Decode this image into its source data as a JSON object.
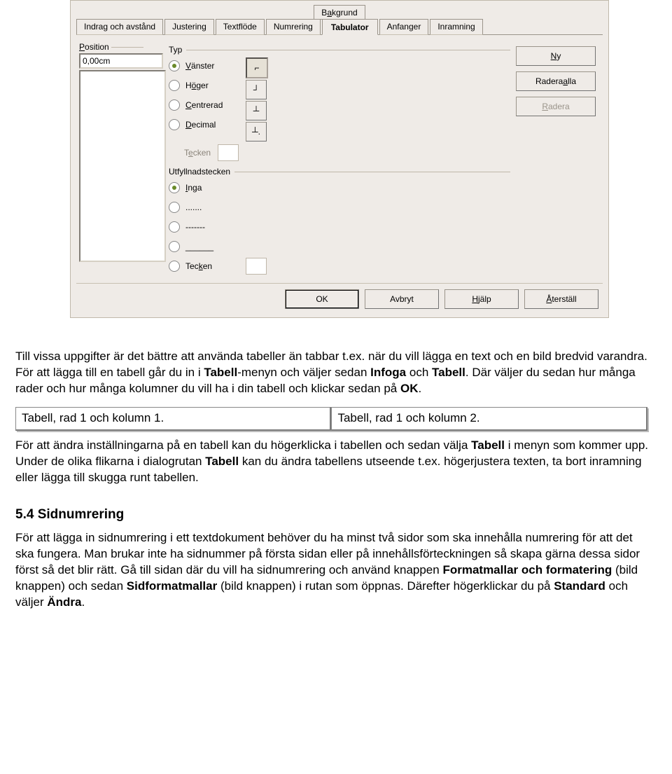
{
  "dialog": {
    "tabs_row1": [
      {
        "label": "Bakgrund",
        "accel": "a"
      }
    ],
    "tabs_row2": [
      {
        "label": "Indrag och avstånd",
        "accel": ""
      },
      {
        "label": "Justering",
        "accel": ""
      },
      {
        "label": "Textflöde",
        "accel": ""
      },
      {
        "label": "Numrering",
        "accel": ""
      },
      {
        "label": "Tabulator",
        "accel": "",
        "active": true
      },
      {
        "label": "Anfanger",
        "accel": ""
      },
      {
        "label": "Inramning",
        "accel": ""
      }
    ],
    "groups": {
      "position": {
        "legend": "Position",
        "accel": "P",
        "value": "0,00cm"
      },
      "typ": {
        "legend": "Typ",
        "options": [
          {
            "label": "Vänster",
            "accel": "V",
            "checked": true
          },
          {
            "label": "Höger",
            "accel": "ö"
          },
          {
            "label": "Centrerad",
            "accel": "C"
          },
          {
            "label": "Decimal",
            "accel": "D"
          }
        ],
        "tecken_label": "Tecken",
        "accel": "e"
      },
      "fill": {
        "legend": "Utfyllnadstecken",
        "options": [
          {
            "label": "Inga",
            "accel": "I",
            "checked": true
          },
          {
            "label": ".......",
            "accel": "."
          },
          {
            "label": "-------",
            "accel": "-"
          },
          {
            "label": "______",
            "accel": "_"
          },
          {
            "label": "Tecken",
            "accel": "T"
          }
        ]
      }
    },
    "side_buttons": [
      {
        "label": "Ny",
        "accel": "N"
      },
      {
        "label": "Radera alla",
        "accel": "a"
      },
      {
        "label": "Radera",
        "accel": "R",
        "disabled": true
      }
    ],
    "bottom": [
      {
        "label": "OK",
        "default": true
      },
      {
        "label": "Avbryt"
      },
      {
        "label": "Hjälp",
        "accel": "H"
      },
      {
        "label": "Återställ",
        "accel": "Å"
      }
    ]
  },
  "article": {
    "p1_a": "Till vissa uppgifter är det bättre att använda tabeller än tabbar t.ex. när du vill lägga en text och en bild bredvid varandra. För att lägga till en tabell går du in i ",
    "p1_b1": "Tabell",
    "p1_c": "-menyn och väljer sedan ",
    "p1_b2": "Infoga",
    "p1_d": " och ",
    "p1_b3": "Tabell",
    "p1_e": ". Där väljer du sedan hur många rader och hur många kolumner du vill ha i din tabell och klickar sedan på ",
    "p1_b4": "OK",
    "p1_f": ".",
    "cell1": "Tabell, rad 1 och kolumn 1.",
    "cell2": "Tabell, rad 1 och kolumn 2.",
    "p2_a": "För att ändra inställningarna på en tabell kan du högerklicka i tabellen och sedan välja ",
    "p2_b1": "Tabell",
    "p2_b": " i menyn som kommer upp. Under de olika flikarna i dialogrutan ",
    "p2_b2": "Tabell",
    "p2_c": " kan du ändra tabellens utseende t.ex. högerjustera texten, ta bort inramning eller lägga till skugga runt tabellen.",
    "h3": "5.4 Sidnumrering",
    "p3_a": "För att lägga in sidnumrering i ett textdokument behöver du ha minst två sidor som ska innehålla numrering för att det ska fungera. Man brukar inte ha sidnummer på första sidan eller på innehållsförteckningen så skapa gärna dessa sidor först så det blir rätt. Gå till sidan där du vill ha sidnumrering och använd knappen ",
    "p3_b1": "Formatmallar och formatering",
    "p3_b": " (bild knappen) och sedan ",
    "p3_b2": "Sidformatmallar",
    "p3_c": " (bild knappen) i rutan som öppnas. Därefter högerklickar du på ",
    "p3_b3": "Standard",
    "p3_d": " och väljer ",
    "p3_b4": "Ändra",
    "p3_e": "."
  }
}
